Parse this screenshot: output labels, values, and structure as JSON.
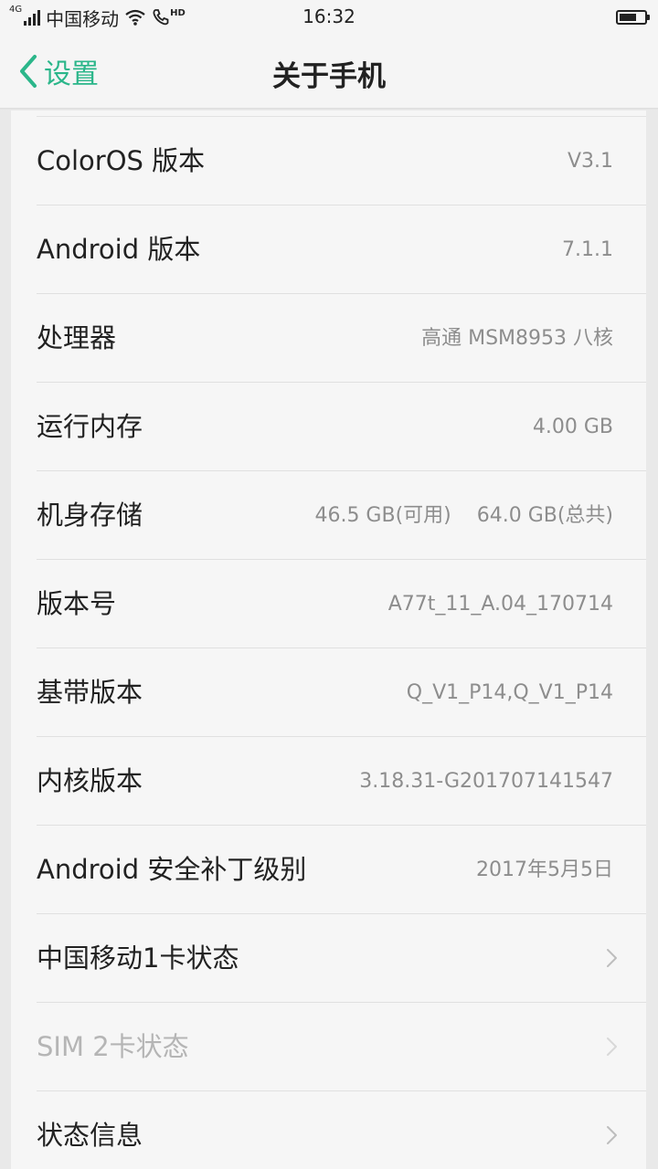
{
  "status_bar": {
    "network_type": "4G",
    "carrier": "中国移动",
    "hd_label": "HD",
    "time": "16:32",
    "battery_level": 0.7
  },
  "nav": {
    "back_label": "设置",
    "title": "关于手机",
    "accent_color": "#2bb68a"
  },
  "rows": [
    {
      "label": "ColorOS 版本",
      "value": "V3.1"
    },
    {
      "label": "Android 版本",
      "value": "7.1.1"
    },
    {
      "label": "处理器",
      "value": "高通 MSM8953 八核"
    },
    {
      "label": "运行内存",
      "value": "4.00 GB"
    },
    {
      "label": "机身存储",
      "value": "46.5 GB(可用)    64.0 GB(总共)"
    },
    {
      "label": "版本号",
      "value": "A77t_11_A.04_170714"
    },
    {
      "label": "基带版本",
      "value": "Q_V1_P14,Q_V1_P14"
    },
    {
      "label": "内核版本",
      "value": "3.18.31-G201707141547"
    },
    {
      "label": "Android 安全补丁级别",
      "value": "2017年5月5日"
    },
    {
      "label": "中国移动1卡状态",
      "value": ""
    },
    {
      "label": "SIM 2卡状态",
      "value": ""
    },
    {
      "label": "状态信息",
      "value": ""
    }
  ],
  "icons": {
    "back": "chevron-left-icon",
    "row_arrow": "chevron-right-icon"
  }
}
